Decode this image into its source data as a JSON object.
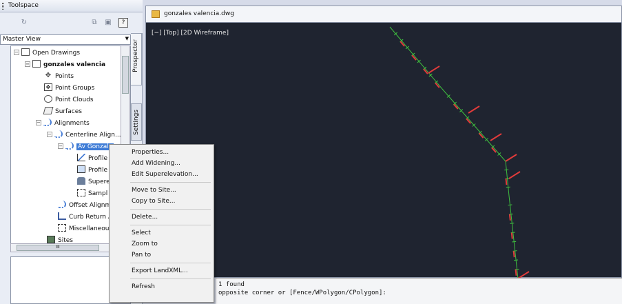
{
  "toolspace": {
    "title": "Toolspace",
    "master_view": "Master View",
    "help_icon_text": "?",
    "tabs": {
      "prospector": "Prospector",
      "settings": "Settings"
    },
    "tree": [
      {
        "label": "Open Drawings"
      },
      {
        "label": "gonzales valencia"
      },
      {
        "label": "Points"
      },
      {
        "label": "Point Groups"
      },
      {
        "label": "Point Clouds"
      },
      {
        "label": "Surfaces"
      },
      {
        "label": "Alignments"
      },
      {
        "label": "Centerline Align..."
      },
      {
        "label": "Av Gonzale"
      },
      {
        "label": "Profile"
      },
      {
        "label": "Profile"
      },
      {
        "label": "Supere"
      },
      {
        "label": "Sampl"
      },
      {
        "label": "Offset Alignm"
      },
      {
        "label": "Curb Return A"
      },
      {
        "label": "Miscellaneous"
      },
      {
        "label": "Sites"
      }
    ],
    "hscroll_grip": "III"
  },
  "drawing": {
    "tab_title": "gonzales valencia.dwg",
    "viewport_label": "[−] [Top] [2D Wireframe]",
    "colors": {
      "background": "#1f2430",
      "alignment": "#3fbf3f",
      "labels": "#e23b3b"
    }
  },
  "command_line": {
    "lines": [
      "1 found",
      "opposite corner or [Fence/WPolygon/CPolygon]:"
    ]
  },
  "context_menu": {
    "items": [
      {
        "label": "Properties..."
      },
      {
        "label": "Add Widening..."
      },
      {
        "label": "Edit Superelevation..."
      },
      {
        "label": "Move to Site..."
      },
      {
        "label": "Copy to Site..."
      },
      {
        "label": "Delete..."
      },
      {
        "label": "Select"
      },
      {
        "label": "Zoom to"
      },
      {
        "label": "Pan to"
      },
      {
        "label": "Export LandXML..."
      },
      {
        "label": "Refresh"
      }
    ]
  }
}
